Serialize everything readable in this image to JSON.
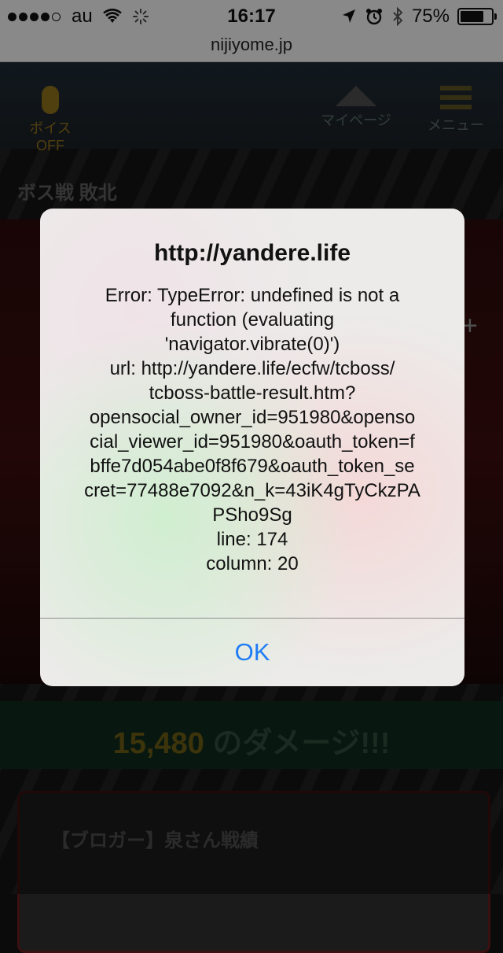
{
  "status_bar": {
    "carrier": "au",
    "time": "16:17",
    "battery": "75%",
    "battery_level": 0.75,
    "signal_bars": 4,
    "signal_total": 5
  },
  "url_bar": {
    "host": "nijiyome.jp"
  },
  "background_page": {
    "nav": {
      "voice": "ボイスOFF",
      "mypage": "マイページ",
      "menu": "メニュー"
    },
    "boss_title": "ボス戦 敗北",
    "damage_value": "15,480",
    "damage_suffix": " のダメージ!!!",
    "blogger_title": "【ブロガー】泉さん戦績"
  },
  "alert": {
    "title": "http://yandere.life",
    "message_lines": [
      "Error: TypeError: undefined is not a",
      "function (evaluating",
      "'navigator.vibrate(0)')",
      "url: http://yandere.life/ecfw/tcboss/",
      "tcboss-battle-result.htm?",
      "opensocial_owner_id=951980&openso",
      "cial_viewer_id=951980&oauth_token=f",
      "bffe7d054abe0f8f679&oauth_token_se",
      "cret=77488e7092&n_k=43iK4gTyCkzPA",
      "PSho9Sg",
      "line: 174",
      "column: 20"
    ],
    "ok_label": "OK"
  },
  "colors": {
    "ok_blue": "#1f7cf4",
    "damage_gold": "#6a5a14"
  }
}
